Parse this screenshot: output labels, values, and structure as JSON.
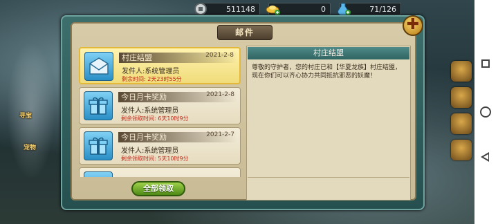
{
  "resources": {
    "silver": "511148",
    "gold": "0",
    "stamina": "71/126"
  },
  "background_labels": {
    "left_1": "寻宝",
    "left_2": "宠物"
  },
  "mail_panel": {
    "title": "邮件",
    "close_icon": "plus-close-icon",
    "claim_all_label": "全部领取"
  },
  "mails": [
    {
      "title": "村庄结盟",
      "date": "2021-2-8",
      "sender": "发件人:系统管理员",
      "remaining": "剩余时间: 2天23时55分",
      "icon": "letter-icon"
    },
    {
      "title": "今日月卡奖励",
      "date": "2021-2-8",
      "sender": "发件人:系统管理员",
      "remaining": "剩余领取时间: 6天10时9分",
      "icon": "gift-box-icon"
    },
    {
      "title": "今日月卡奖励",
      "date": "2021-2-7",
      "sender": "发件人:系统管理员",
      "remaining": "剩余领取时间: 5天10时9分",
      "icon": "gift-box-icon"
    }
  ],
  "detail": {
    "header": "村庄结盟",
    "body": "尊敬的守护者，您的村庄已和【华夏龙族】村庄结盟，现在你们可以齐心协力共同抵抗邪恶的妖魔！"
  },
  "colors": {
    "accent_gold": "#f0dc7a",
    "panel_teal": "#3d6f6d",
    "remaining_red": "#c22a1a",
    "claim_green": "#6fae2a"
  }
}
